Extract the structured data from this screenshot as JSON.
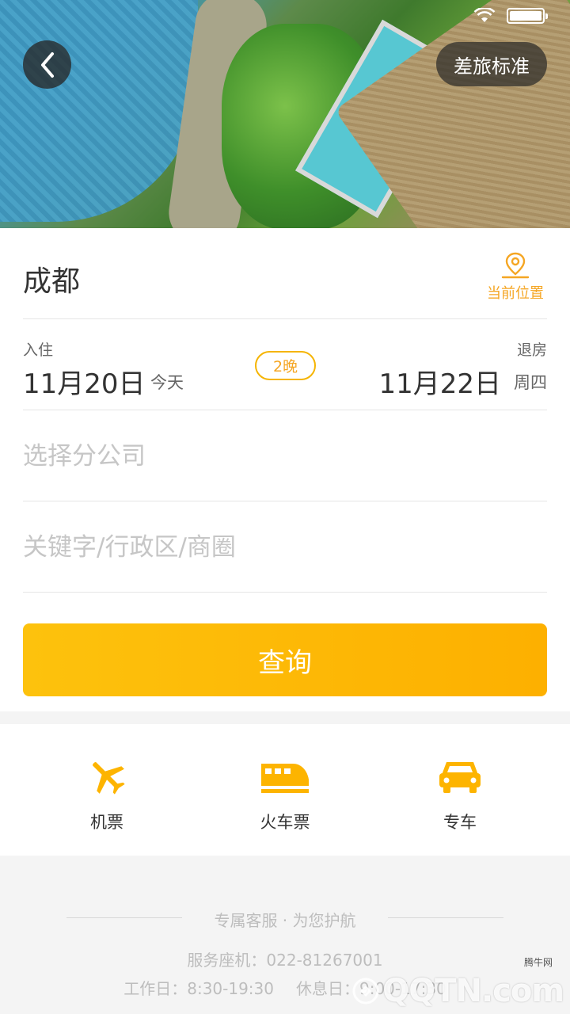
{
  "header": {
    "travel_policy_label": "差旅标准"
  },
  "search": {
    "city": "成都",
    "location_label": "当前位置",
    "checkin_label": "入住",
    "checkin_date": "11月20日",
    "checkin_day": "今天",
    "nights": "2晚",
    "checkout_label": "退房",
    "checkout_date": "11月22日",
    "checkout_day": "周四",
    "company_placeholder": "选择分公司",
    "keyword_placeholder": "关键字/行政区/商圈",
    "search_label": "查询"
  },
  "services": [
    {
      "label": "机票",
      "icon": "airplane-icon"
    },
    {
      "label": "火车票",
      "icon": "train-icon"
    },
    {
      "label": "专车",
      "icon": "car-icon"
    }
  ],
  "footer": {
    "slogan": "专属客服 · 为您护航",
    "phone": "服务座机：022-81267001",
    "workday_hours": "工作日：8:30-19:30",
    "holiday_hours": "休息日：9:00-17:30"
  },
  "watermark": {
    "brand": "QQTN.com",
    "sub": "腾牛网"
  },
  "colors": {
    "accent": "#fdb800",
    "accent_text": "#f5a623"
  }
}
